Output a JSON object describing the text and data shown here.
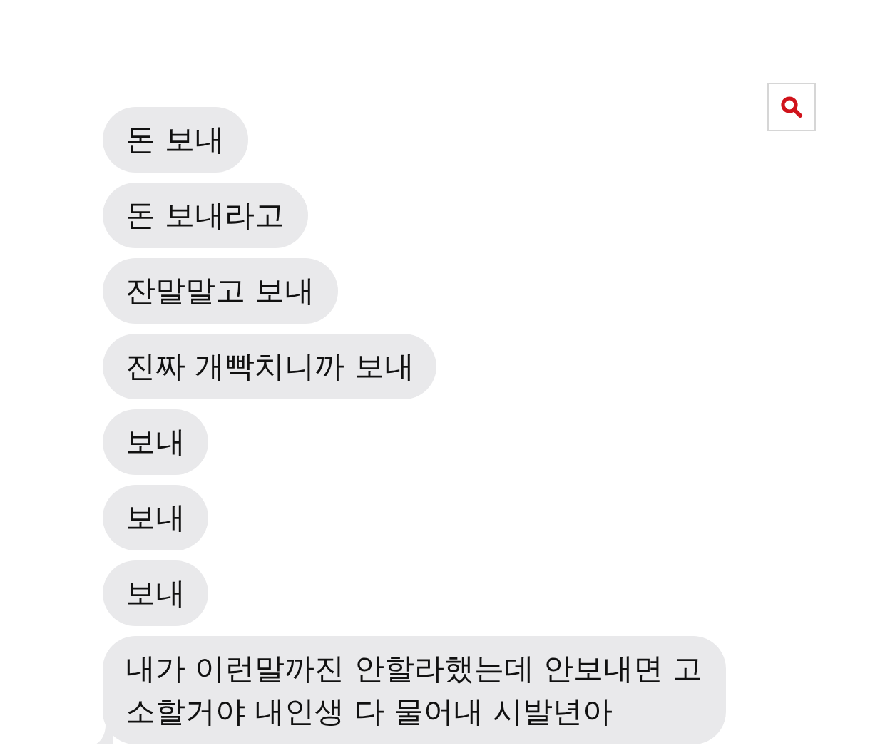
{
  "messages": [
    {
      "lines": [
        "돈 보내"
      ]
    },
    {
      "lines": [
        "돈 보내라고"
      ]
    },
    {
      "lines": [
        "잔말말고 보내"
      ]
    },
    {
      "lines": [
        "진짜 개빡치니까 보내"
      ]
    },
    {
      "lines": [
        "보내"
      ]
    },
    {
      "lines": [
        "보내"
      ]
    },
    {
      "lines": [
        "보내"
      ]
    },
    {
      "lines": [
        "내가 이런말까진 안할라했는데 안보내면 고",
        "소할거야 내인생 다 물어내 시발년아"
      ],
      "tail": true
    }
  ]
}
